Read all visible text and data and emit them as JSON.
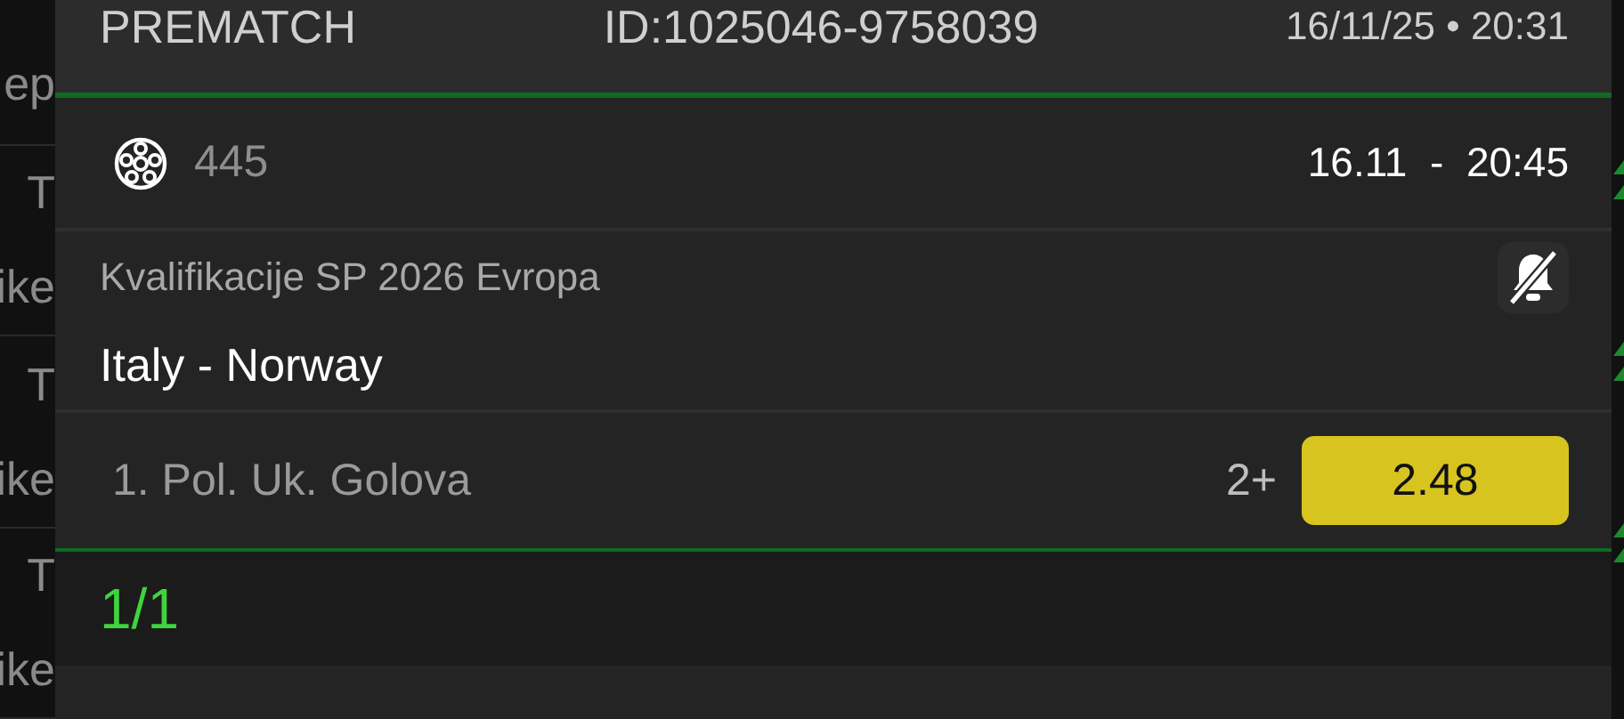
{
  "background_list": [
    {
      "subtitle": "ep"
    },
    {
      "title": "T",
      "subtitle": "ike"
    },
    {
      "title": "T",
      "subtitle": "ike"
    },
    {
      "title": "T",
      "subtitle": "ike"
    }
  ],
  "ticket": {
    "type": "PREMATCH",
    "id": "ID:1025046-9758039",
    "datetime": "16/11/25 • 20:31",
    "event": {
      "code": "445",
      "date": "16.11",
      "separator": "-",
      "time": "20:45",
      "league": "Kvalifikacije SP 2026 Evropa",
      "match": "Italy - Norway",
      "muted": true,
      "bet": {
        "market": "1. Pol. Uk. Golova",
        "pick": "2+",
        "odds": "2.48"
      }
    },
    "page": "1/1"
  }
}
